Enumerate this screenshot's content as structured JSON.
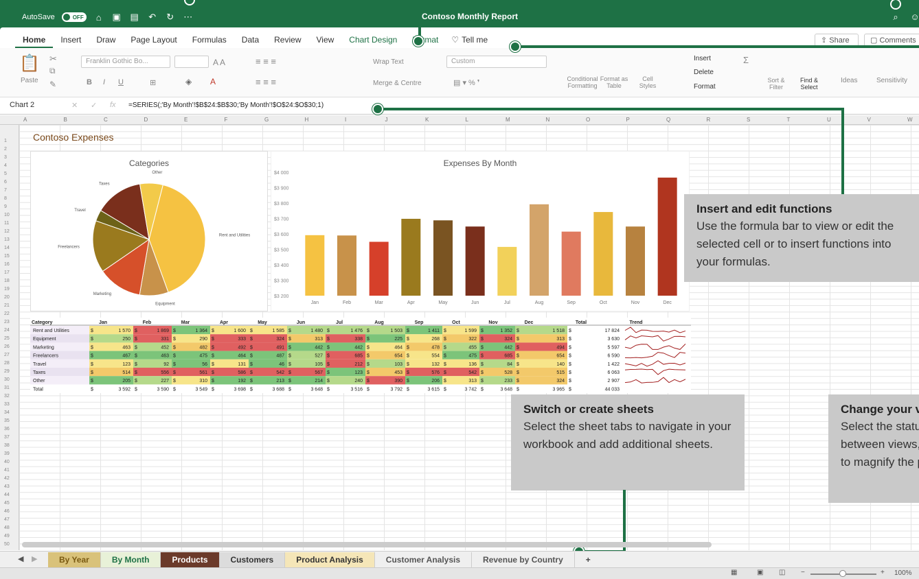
{
  "titlebar": {
    "autosave_label": "AutoSave",
    "autosave_state": "OFF",
    "doc_title": "Contoso Monthly Report"
  },
  "tabs": [
    "Home",
    "Insert",
    "Draw",
    "Page Layout",
    "Formulas",
    "Data",
    "Review",
    "View",
    "Chart Design",
    "Format"
  ],
  "tell_me": "Tell me",
  "share_label": "Share",
  "comments_label": "Comments",
  "ribbon": {
    "paste": "Paste",
    "font_name": "Franklin Gothic Bo...",
    "wrap_text": "Wrap Text",
    "merge_center": "Merge & Centre",
    "number_format": "Custom",
    "conditional": "Conditional Formatting",
    "format_table": "Format as Table",
    "cell_styles": "Cell Styles",
    "insert": "Insert",
    "delete": "Delete",
    "format": "Format",
    "sort_filter": "Sort & Filter",
    "find_select": "Find & Select",
    "ideas": "Ideas",
    "sensitivity": "Sensitivity"
  },
  "formula_bar": {
    "name_box": "Chart 2",
    "fx": "fx",
    "formula": "=SERIES(;'By Month'!$B$24:$B$30;'By Month'!$O$24:$O$30;1)"
  },
  "columns": [
    "A",
    "B",
    "C",
    "D",
    "E",
    "F",
    "G",
    "H",
    "I",
    "J",
    "K",
    "L",
    "M",
    "N",
    "O",
    "P",
    "Q",
    "R",
    "S",
    "T",
    "U",
    "V",
    "W"
  ],
  "sheet_title": "Contoso Expenses",
  "pie_chart": {
    "title": "Categories",
    "labels": [
      "Rent and Utilities",
      "Equipment",
      "Marketing",
      "Freelancers",
      "Travel",
      "Taxes",
      "Other"
    ]
  },
  "chart_data": {
    "type": "bar",
    "title": "Expenses By Month",
    "categories": [
      "Jan",
      "Feb",
      "Mar",
      "Apr",
      "May",
      "Jun",
      "Jul",
      "Aug",
      "Sep",
      "Oct",
      "Nov",
      "Dec"
    ],
    "values": [
      3592,
      3590,
      3549,
      3698,
      3688,
      3648,
      3516,
      3792,
      3615,
      3742,
      3648,
      3965
    ],
    "ylim": [
      3200,
      4000
    ],
    "yticks": [
      "$3 200",
      "$3 300",
      "$3 400",
      "$3 500",
      "$3 600",
      "$3 700",
      "$3 800",
      "$3 900",
      "$4 000"
    ],
    "colors": [
      "#f5c242",
      "#c8924a",
      "#d6402a",
      "#9a7a1e",
      "#7a5422",
      "#7a2f1c",
      "#f2d15a",
      "#d3a46a",
      "#e07a5f",
      "#e8b83c",
      "#b7823f",
      "#b0351f"
    ]
  },
  "table": {
    "headers": [
      "Category",
      "Jan",
      "Feb",
      "Mar",
      "Apr",
      "May",
      "Jun",
      "Jul",
      "Aug",
      "Sep",
      "Oct",
      "Nov",
      "Dec",
      "Total",
      "Trend"
    ],
    "rows": [
      [
        "Rent and Utilities",
        "1 570",
        "1 869",
        "1 364",
        "1 600",
        "1 585",
        "1 480",
        "1 476",
        "1 503",
        "1 411",
        "1 599",
        "1 352",
        "1 518",
        "17 824"
      ],
      [
        "Equipment",
        "250",
        "331",
        "290",
        "333",
        "324",
        "313",
        "338",
        "225",
        "268",
        "322",
        "324",
        "313",
        "3 630"
      ],
      [
        "Marketing",
        "463",
        "452",
        "482",
        "492",
        "491",
        "442",
        "442",
        "464",
        "478",
        "455",
        "442",
        "494",
        "5 597"
      ],
      [
        "Freelancers",
        "467",
        "463",
        "475",
        "464",
        "487",
        "527",
        "685",
        "654",
        "554",
        "475",
        "685",
        "654",
        "6 590"
      ],
      [
        "Travel",
        "123",
        "92",
        "56",
        "131",
        "46",
        "105",
        "212",
        "103",
        "132",
        "136",
        "84",
        "140",
        "1 422"
      ],
      [
        "Taxes",
        "514",
        "556",
        "561",
        "586",
        "542",
        "567",
        "123",
        "453",
        "576",
        "542",
        "528",
        "515",
        "6 063"
      ],
      [
        "Other",
        "205",
        "227",
        "310",
        "192",
        "213",
        "214",
        "240",
        "390",
        "206",
        "313",
        "233",
        "324",
        "2 907"
      ]
    ],
    "total_row": [
      "Total",
      "3 592",
      "3 590",
      "3 549",
      "3 698",
      "3 688",
      "3 648",
      "3 516",
      "3 792",
      "3 615",
      "3 742",
      "3 648",
      "3 965",
      "44 033"
    ]
  },
  "callouts": {
    "functions_title": "Insert and edit functions",
    "functions_body": "Use the formula bar to view or edit the selected cell or to insert functions into your formulas.",
    "sheets_title": "Switch or create sheets",
    "sheets_body": "Select the sheet tabs to navigate in your workbook and add additional sheets.",
    "view_title": "Change your view",
    "view_body": "Select the status bar buttons to switch between views, or use the zoom slider to magnify the page display."
  },
  "sheet_tabs": [
    {
      "label": "By Year",
      "bg": "#d9c27a",
      "color": "#7a5a12"
    },
    {
      "label": "By Month",
      "bg": "#e8f1d8",
      "color": "#1e7145"
    },
    {
      "label": "Products",
      "bg": "#6b3a2a",
      "color": "#ffffff"
    },
    {
      "label": "Customers",
      "bg": "#dcdcdc",
      "color": "#333333"
    },
    {
      "label": "Product Analysis",
      "bg": "#f5e6b8",
      "color": "#333333"
    },
    {
      "label": "Customer Analysis",
      "bg": "#efefef",
      "color": "#555555"
    },
    {
      "label": "Revenue by Country",
      "bg": "#efefef",
      "color": "#555555"
    }
  ],
  "add_sheet": "+",
  "zoom": "100%"
}
